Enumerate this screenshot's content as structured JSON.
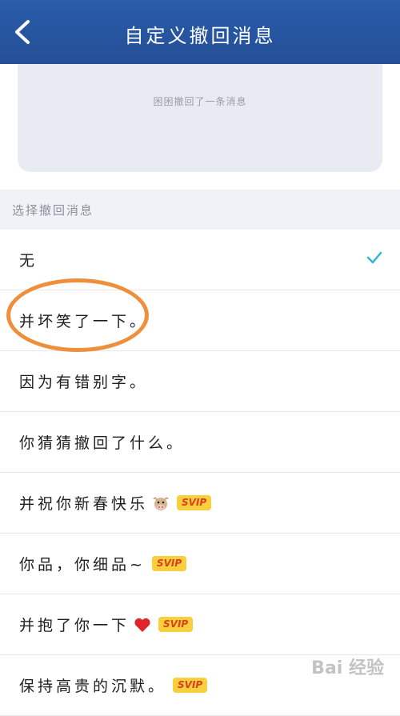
{
  "header": {
    "title": "自定义撤回消息",
    "back_icon": "chevron-left-icon"
  },
  "preview": {
    "text": "困困撤回了一条消息"
  },
  "section": {
    "title": "选择撤回消息"
  },
  "options": [
    {
      "label": "无",
      "selected": true
    },
    {
      "label": "并坏笑了一下。"
    },
    {
      "label": "因为有错别字。"
    },
    {
      "label": "你猜猜撤回了什么。"
    },
    {
      "label": "并祝你新春快乐",
      "emoji": "cow-face-icon",
      "badge": "SVIP"
    },
    {
      "label": "你品，你细品~",
      "badge": "SVIP"
    },
    {
      "label": "并抱了你一下",
      "emoji": "red-heart-icon",
      "badge": "SVIP"
    },
    {
      "label": "保持高贵的沉默。",
      "badge": "SVIP"
    }
  ],
  "colors": {
    "header_bg": "#2a5dab",
    "check": "#2db8d6",
    "highlight": "#ee8f3c",
    "badge_bg": "#f8cf3c",
    "badge_text": "#d9401f"
  },
  "watermark": {
    "text": "Bai 经验"
  }
}
